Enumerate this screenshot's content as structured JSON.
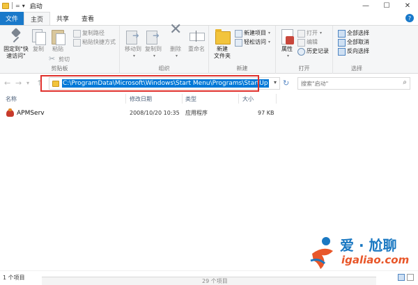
{
  "window": {
    "title": "启动",
    "qat_label": "="
  },
  "tabs": {
    "file": "文件",
    "home": "主页",
    "share": "共享",
    "view": "查看"
  },
  "ribbon": {
    "clipboard": {
      "label": "剪贴板",
      "pin": "固定到\"快\n速访问\"",
      "copy": "复制",
      "paste": "粘贴",
      "copy_path": "复制路径",
      "paste_shortcut": "粘贴快捷方式",
      "cut": "剪切"
    },
    "organize": {
      "label": "组织",
      "move_to": "移动到",
      "copy_to": "复制到",
      "delete": "删除",
      "rename": "重命名"
    },
    "new": {
      "label": "新建",
      "new_folder": "新建\n文件夹",
      "new_item": "新建项目",
      "easy_access": "轻松访问"
    },
    "open": {
      "label": "打开",
      "properties": "属性",
      "open": "打开",
      "edit": "编辑",
      "history": "历史记录"
    },
    "select": {
      "label": "选择",
      "select_all": "全部选择",
      "select_none": "全部取消",
      "invert": "反向选择"
    }
  },
  "navigation": {
    "address": "C:\\ProgramData\\Microsoft\\Windows\\Start Menu\\Programs\\StartUp",
    "search_placeholder": "搜索\"启动\""
  },
  "file_list": {
    "columns": [
      "名称",
      "修改日期",
      "类型",
      "大小"
    ],
    "rows": [
      {
        "name": "APMServ",
        "date": "2008/10/20 10:35",
        "type": "应用程序",
        "size": "97 KB"
      }
    ]
  },
  "status": {
    "item_count": "1 个项目",
    "behind_window": "29 个项目"
  },
  "watermark": {
    "title": "爱 · 尬聊",
    "url": "igaliao.com"
  },
  "colors": {
    "accent": "#1979ca",
    "highlight_box": "#e0302c",
    "selection": "#0078d7"
  }
}
